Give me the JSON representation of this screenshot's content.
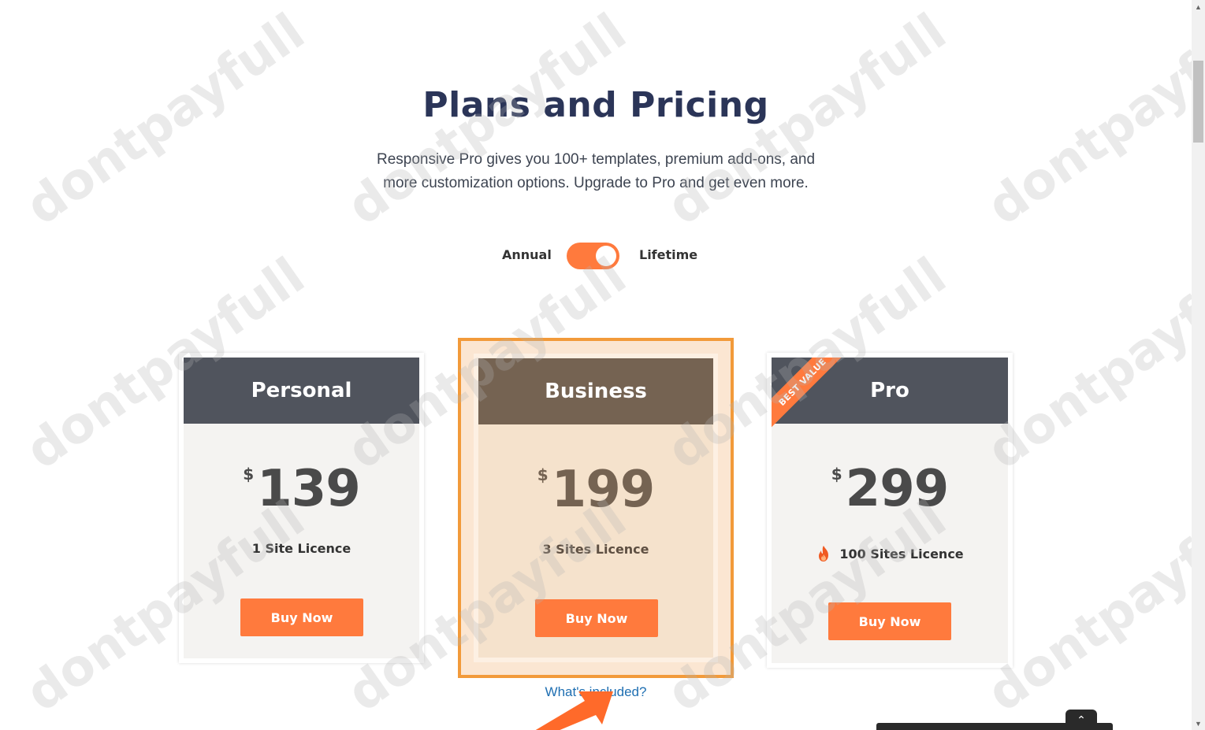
{
  "header": {
    "title": "Plans and Pricing",
    "subtitle": "Responsive Pro gives you 100+ templates, premium add-ons, and more customization options. Upgrade to Pro and get even more."
  },
  "billing_toggle": {
    "left_label": "Annual",
    "right_label": "Lifetime",
    "selected": "Lifetime"
  },
  "plans": [
    {
      "name": "Personal",
      "currency": "$",
      "price": "139",
      "licence": "1 Site Licence",
      "button": "Buy Now"
    },
    {
      "name": "Business",
      "currency": "$",
      "price": "199",
      "licence": "3 Sites Licence",
      "button": "Buy Now",
      "highlighted": true
    },
    {
      "name": "Pro",
      "currency": "$",
      "price": "299",
      "licence": "100 Sites Licence",
      "button": "Buy Now",
      "ribbon": "BEST VALUE",
      "licence_icon": "flame-icon"
    }
  ],
  "included_link": "What's included?",
  "watermark": "dontpayfull",
  "colors": {
    "accent": "#ff7a3d",
    "title": "#2b3558",
    "card_head": "#50545d",
    "business_head": "#756352",
    "highlight_border": "#f29a3a",
    "link": "#1f6fb2"
  }
}
